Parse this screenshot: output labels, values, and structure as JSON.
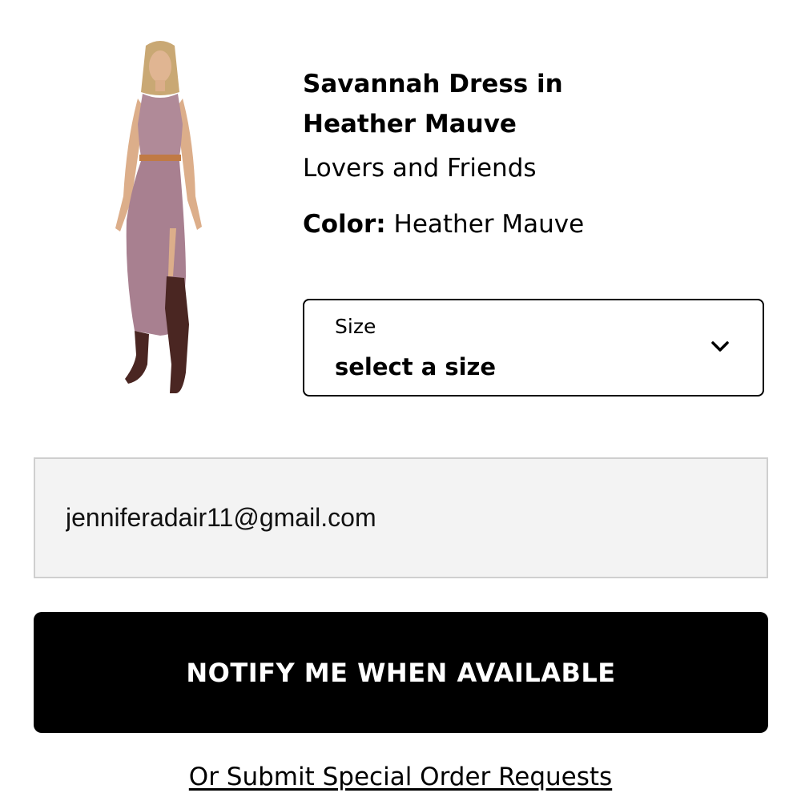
{
  "product": {
    "title": "Savannah Dress in Heather Mauve",
    "brand": "Lovers and Friends",
    "color_label": "Color:",
    "color_value": "Heather Mauve",
    "dress_color": "#b08a98",
    "belt_color": "#c07a45",
    "boot_color": "#4a2622"
  },
  "size": {
    "label": "Size",
    "value": "select a size",
    "icon": "chevron-down-icon"
  },
  "email": {
    "value": "jenniferadair11@gmail.com"
  },
  "actions": {
    "notify_label": "NOTIFY ME WHEN AVAILABLE",
    "special_order_label": "Or Submit Special Order Requests"
  }
}
